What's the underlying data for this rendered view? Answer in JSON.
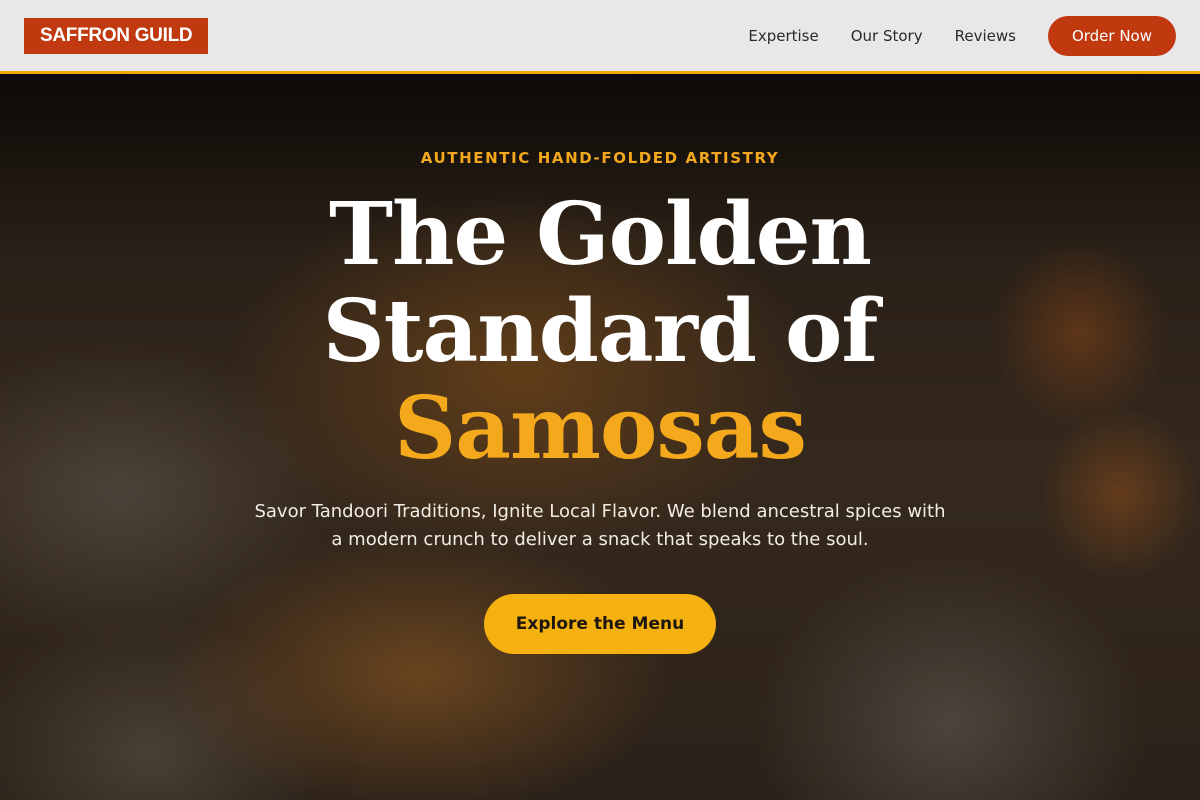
{
  "header": {
    "logo": "SAFFRON GUILD",
    "nav": [
      "Expertise",
      "Our Story",
      "Reviews"
    ],
    "order_label": "Order Now"
  },
  "hero": {
    "eyebrow": "AUTHENTIC HAND-FOLDED ARTISTRY",
    "title_line1": "The Golden",
    "title_line2": "Standard of",
    "title_accent": "Samosas",
    "subtitle": "Savor Tandoori Traditions, Ignite Local Flavor. We blend ancestral spices with a modern crunch to deliver a snack that speaks to the soul.",
    "cta_label": "Explore the Menu"
  },
  "colors": {
    "brand": "#c0390f",
    "accent": "#f4a81c",
    "header_bg": "#e8e8e8"
  }
}
